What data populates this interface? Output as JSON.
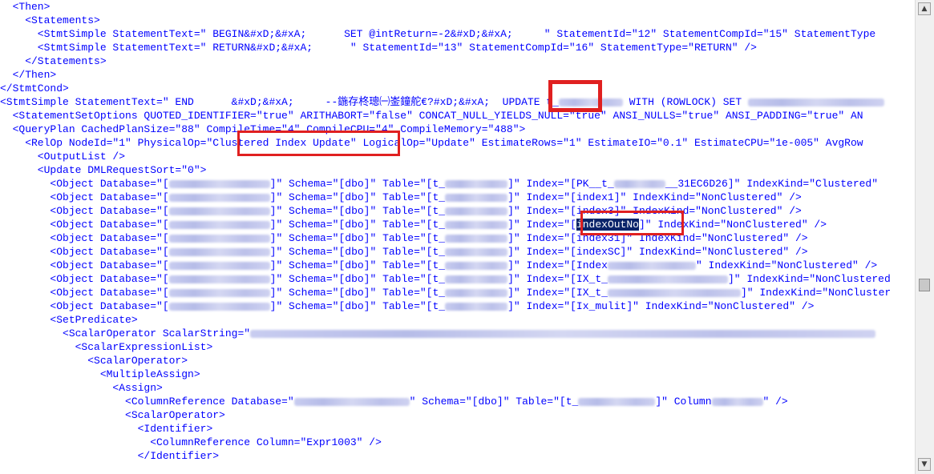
{
  "lines": [
    "  <Then>",
    "    <Statements>",
    "      <StmtSimple StatementText=\" BEGIN&#xD;&#xA;      SET @intReturn=-2&#xD;&#xA;     \" StatementId=\"12\" StatementCompId=\"15\" StatementType",
    "      <StmtSimple StatementText=\" RETURN&#xD;&#xA;      \" StatementId=\"13\" StatementCompId=\"16\" StatementType=\"RETURN\" />",
    "    </Statements>",
    "  </Then>",
    "</StmtCond>",
    "<StmtSimple StatementText=\" END      &#xD;&#xA;     --鍦存柊璁㈠崟鐘舵€?#xD;&#xA;  UPDATE t_",
    "  <StatementSetOptions QUOTED_IDENTIFIER=\"true\" ARITHABORT=\"false\" CONCAT_NULL_YIELDS_NULL=\"true\" ANSI_NULLS=\"true\" ANSI_PADDING=\"true\" AN",
    "  <QueryPlan CachedPlanSize=\"88\" CompileTime=\"4\" CompileCPU=\"4\" CompileMemory=\"488\">",
    "    <RelOp NodeId=\"1\" PhysicalOp=\"Clustered Index Update\" LogicalOp=\"Update\" EstimateRows=\"1\" EstimateIO=\"0.1\" EstimateCPU=\"1e-005\" AvgRow",
    "      <OutputList />",
    "      <Update DMLRequestSort=\"0\">",
    "        <Object Database=\"[",
    "        <Object Database=\"[",
    "        <Object Database=\"[",
    "        <Object Database=\"[",
    "        <Object Database=\"[",
    "        <Object Database=\"[",
    "        <Object Database=\"[",
    "        <Object Database=\"[",
    "        <Object Database=\"[",
    "        <Object Database=\"[",
    "        <SetPredicate>",
    "          <ScalarOperator ScalarString=\"",
    "            <ScalarExpressionList>",
    "              <ScalarOperator>",
    "                <MultipleAssign>",
    "                  <Assign>",
    "                    <ColumnReference Database=\"",
    "                    <ScalarOperator>",
    "                      <Identifier>",
    "                        <ColumnReference Column=\"Expr1003\" />",
    "                      </Identifier>"
  ],
  "update_stmt": {
    "tail1": " WITH (ROWLOCK) SET "
  },
  "object_rows": [
    {
      "index": "PK__t_",
      "index_tail": "__31EC6D26]",
      "kind": "Clustered"
    },
    {
      "index": "[index1]",
      "kind": "NonClustered"
    },
    {
      "index": "[index3]",
      "kind": "NonClustered"
    },
    {
      "index": "indexOutNo",
      "kind": "NonClustered"
    },
    {
      "index": "[index31]",
      "kind": "NonClustered"
    },
    {
      "index": "[indexSC]",
      "kind": "NonClustered"
    },
    {
      "index": "[Index",
      "kind": "NonClustered"
    },
    {
      "index": "[IX_t_",
      "kind": "NonClustered"
    },
    {
      "index": "[IX_t_",
      "kind": "NonCluster"
    },
    {
      "index": "[Ix_mulit]",
      "kind": "NonClustered"
    }
  ],
  "object_text": {
    "schema_label": " Schema=\"[dbo]\" Table=\"[t_",
    "index_label": " Index=\"",
    "kind_label": " IndexKind=\""
  },
  "colref": {
    "schema": "\" Schema=\"[dbo]\" Table=\"[t_",
    "column": "]\" Column"
  },
  "highlights": {
    "update_keyword": "UPDATE",
    "physical_op_value": "\"Clustered Index Update\"",
    "selected_index": "indexOutNo"
  },
  "colors": {
    "tag": "#0000ff",
    "attribute": "#c00000",
    "annotation": "#e02020",
    "selection": "#0a246a"
  },
  "scrollbar": {
    "up": "▲",
    "down": "▼"
  }
}
